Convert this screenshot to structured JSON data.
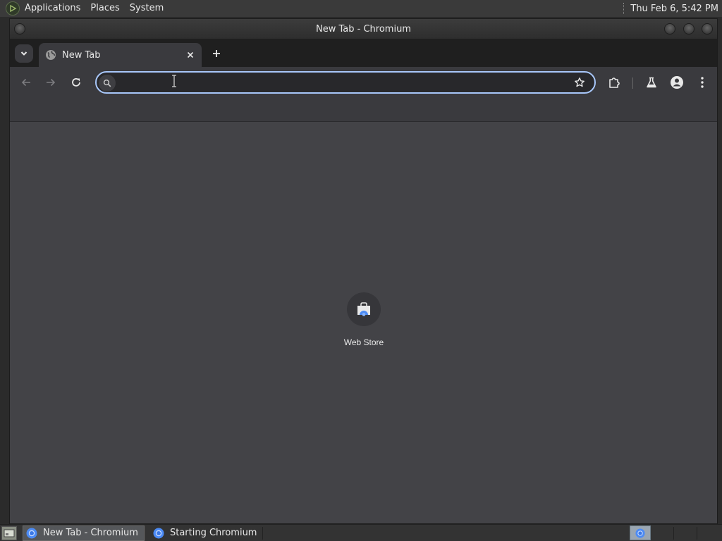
{
  "top_panel": {
    "menus": [
      "Applications",
      "Places",
      "System"
    ],
    "clock": "Thu Feb  6,  5:42 PM"
  },
  "window": {
    "title": "New Tab - Chromium"
  },
  "tabs": [
    {
      "title": "New Tab",
      "active": true
    }
  ],
  "toolbar": {
    "omnibox_value": "",
    "icons": [
      "back-icon",
      "forward-icon",
      "reload-icon",
      "bookmark-star-icon",
      "extensions-icon",
      "labs-icon",
      "profile-icon",
      "menu-icon"
    ]
  },
  "new_tab_page": {
    "shortcuts": [
      {
        "label": "Web Store",
        "icon": "web-store-icon"
      }
    ]
  },
  "taskbar": {
    "tasks": [
      {
        "label": "New Tab - Chromium",
        "active": true
      },
      {
        "label": "Starting Chromium",
        "active": false
      }
    ]
  },
  "colors": {
    "focus_ring": "#a8c7fa",
    "content_bg": "#434347",
    "toolbar_bg": "#3a3a3e",
    "tabstrip_bg": "#1f1f1f"
  }
}
